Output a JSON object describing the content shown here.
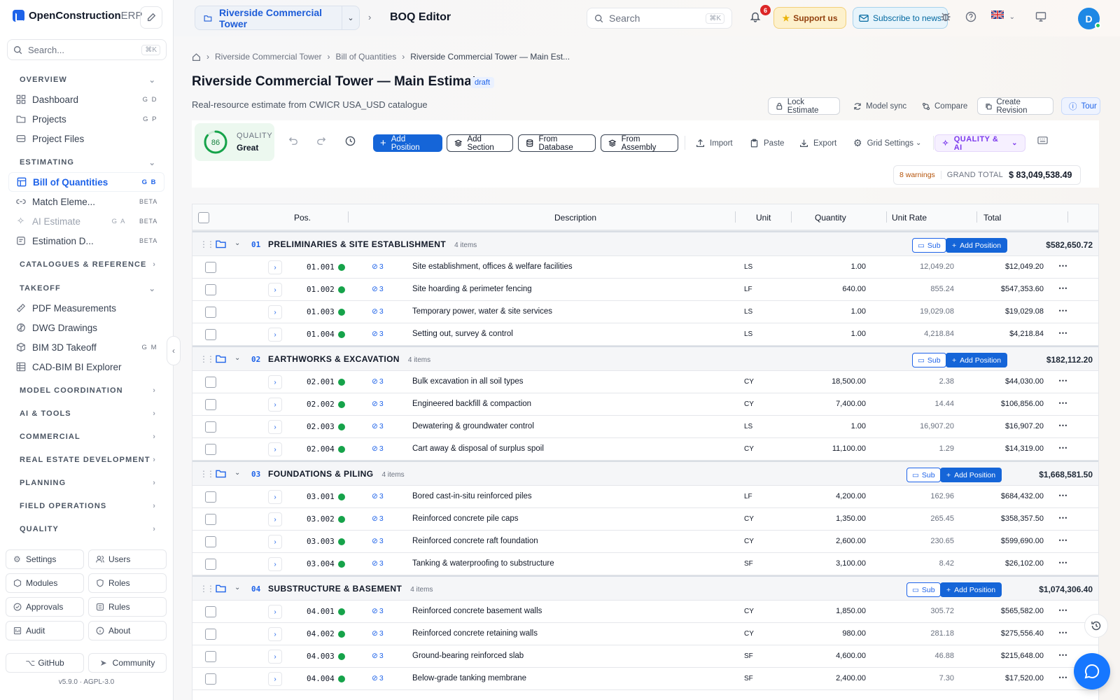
{
  "app": {
    "brand_main": "OpenConstruction",
    "brand_suffix": "ERP",
    "search_placeholder": "Search...",
    "search_shortcut": "⌘K",
    "version": "v5.9.0",
    "license": "AGPL-3.0"
  },
  "sidebar": {
    "sections": [
      {
        "label": "OVERVIEW",
        "expanded": true,
        "items": [
          {
            "label": "Dashboard",
            "icon": "dashboard-icon",
            "shortcut": "G D"
          },
          {
            "label": "Projects",
            "icon": "folder-icon",
            "shortcut": "G P"
          },
          {
            "label": "Project Files",
            "icon": "archive-icon",
            "shortcut": ""
          }
        ]
      },
      {
        "label": "ESTIMATING",
        "expanded": true,
        "items": [
          {
            "label": "Bill of Quantities",
            "icon": "table-icon",
            "shortcut": "G B",
            "active": true
          },
          {
            "label": "Match Eleme...",
            "icon": "link-icon",
            "badge": "BETA"
          },
          {
            "label": "AI Estimate",
            "icon": "sparkle-icon",
            "shortcut": "G A",
            "badge": "BETA",
            "dim": true
          },
          {
            "label": "Estimation D...",
            "icon": "note-icon",
            "badge": "BETA"
          }
        ]
      },
      {
        "label": "CATALOGUES & REFERENCE",
        "expanded": false,
        "items": []
      },
      {
        "label": "TAKEOFF",
        "expanded": true,
        "items": [
          {
            "label": "PDF Measurements",
            "icon": "ruler-icon",
            "shortcut": ""
          },
          {
            "label": "DWG Drawings",
            "icon": "drawing-icon",
            "shortcut": ""
          },
          {
            "label": "BIM 3D Takeoff",
            "icon": "cube-icon",
            "shortcut": "G M"
          },
          {
            "label": "CAD-BIM BI Explorer",
            "icon": "grid-icon",
            "shortcut": ""
          }
        ]
      },
      {
        "label": "MODEL COORDINATION",
        "expanded": false,
        "items": []
      },
      {
        "label": "AI & TOOLS",
        "expanded": false,
        "items": []
      },
      {
        "label": "COMMERCIAL",
        "expanded": false,
        "items": []
      },
      {
        "label": "REAL ESTATE DEVELOPMENT",
        "expanded": false,
        "items": []
      },
      {
        "label": "PLANNING",
        "expanded": false,
        "items": []
      },
      {
        "label": "FIELD OPERATIONS",
        "expanded": false,
        "items": []
      },
      {
        "label": "QUALITY",
        "expanded": false,
        "items": []
      }
    ],
    "footer": [
      {
        "label": "Settings",
        "icon": "gear-icon"
      },
      {
        "label": "Users",
        "icon": "users-icon"
      },
      {
        "label": "Modules",
        "icon": "box-icon"
      },
      {
        "label": "Roles",
        "icon": "shield-icon"
      },
      {
        "label": "Approvals",
        "icon": "check-circle-icon"
      },
      {
        "label": "Rules",
        "icon": "rules-icon"
      },
      {
        "label": "Audit",
        "icon": "audit-icon"
      },
      {
        "label": "About",
        "icon": "info-icon"
      }
    ],
    "github": "GitHub",
    "community": "Community"
  },
  "topbar": {
    "project": "Riverside Commercial Tower",
    "page": "BOQ Editor",
    "search_placeholder": "Search",
    "search_shortcut": "⌘K",
    "notifications": "6",
    "support": "Support us",
    "subscribe": "Subscribe to news",
    "avatar": "D"
  },
  "page": {
    "breadcrumb": [
      "Riverside Commercial Tower",
      "Bill of Quantities",
      "Riverside Commercial Tower — Main Est..."
    ],
    "title": "Riverside Commercial Tower — Main Estimate",
    "status": "draft",
    "subtitle": "Real-resource estimate from CWICR USA_USD catalogue",
    "actions": {
      "lock": "Lock Estimate",
      "model_sync": "Model sync",
      "compare": "Compare",
      "revision": "Create Revision",
      "tour": "Tour"
    }
  },
  "toolbar": {
    "quality_score": "86",
    "quality_score_value": 0.86,
    "quality_label": "QUALITY",
    "quality_value": "Great",
    "add_position": "Add Position",
    "add_section": "Add Section",
    "from_database": "From Database",
    "from_assembly": "From Assembly",
    "import": "Import",
    "paste": "Paste",
    "export": "Export",
    "grid_settings": "Grid Settings",
    "quality_ai": "QUALITY & AI",
    "warnings": "8 warnings",
    "grand_total_label": "GRAND TOTAL",
    "grand_total": "$ 83,049,538.49"
  },
  "grid": {
    "columns": {
      "pos": "Pos.",
      "description": "Description",
      "unit": "Unit",
      "quantity": "Quantity",
      "unit_rate": "Unit Rate",
      "total": "Total"
    },
    "sub_label": "Sub",
    "add_label": "Add Position",
    "sections": [
      {
        "code": "01",
        "title": "PRELIMINARIES & SITE ESTABLISHMENT",
        "count": "4 items",
        "total": "$582,650.72",
        "rows": [
          {
            "pos": "01.001",
            "links": "3",
            "desc": "Site establishment, offices & welfare facilities",
            "unit": "LS",
            "qty": "1.00",
            "rate": "12,049.20",
            "total": "$12,049.20"
          },
          {
            "pos": "01.002",
            "links": "3",
            "desc": "Site hoarding & perimeter fencing",
            "unit": "LF",
            "qty": "640.00",
            "rate": "855.24",
            "total": "$547,353.60"
          },
          {
            "pos": "01.003",
            "links": "3",
            "desc": "Temporary power, water & site services",
            "unit": "LS",
            "qty": "1.00",
            "rate": "19,029.08",
            "total": "$19,029.08"
          },
          {
            "pos": "01.004",
            "links": "3",
            "desc": "Setting out, survey & control",
            "unit": "LS",
            "qty": "1.00",
            "rate": "4,218.84",
            "total": "$4,218.84"
          }
        ]
      },
      {
        "code": "02",
        "title": "EARTHWORKS & EXCAVATION",
        "count": "4 items",
        "total": "$182,112.20",
        "rows": [
          {
            "pos": "02.001",
            "links": "3",
            "desc": "Bulk excavation in all soil types",
            "unit": "CY",
            "qty": "18,500.00",
            "rate": "2.38",
            "total": "$44,030.00"
          },
          {
            "pos": "02.002",
            "links": "3",
            "desc": "Engineered backfill & compaction",
            "unit": "CY",
            "qty": "7,400.00",
            "rate": "14.44",
            "total": "$106,856.00"
          },
          {
            "pos": "02.003",
            "links": "3",
            "desc": "Dewatering & groundwater control",
            "unit": "LS",
            "qty": "1.00",
            "rate": "16,907.20",
            "total": "$16,907.20"
          },
          {
            "pos": "02.004",
            "links": "3",
            "desc": "Cart away & disposal of surplus spoil",
            "unit": "CY",
            "qty": "11,100.00",
            "rate": "1.29",
            "total": "$14,319.00"
          }
        ]
      },
      {
        "code": "03",
        "title": "FOUNDATIONS & PILING",
        "count": "4 items",
        "total": "$1,668,581.50",
        "rows": [
          {
            "pos": "03.001",
            "links": "3",
            "desc": "Bored cast-in-situ reinforced piles",
            "unit": "LF",
            "qty": "4,200.00",
            "rate": "162.96",
            "total": "$684,432.00"
          },
          {
            "pos": "03.002",
            "links": "3",
            "desc": "Reinforced concrete pile caps",
            "unit": "CY",
            "qty": "1,350.00",
            "rate": "265.45",
            "total": "$358,357.50"
          },
          {
            "pos": "03.003",
            "links": "3",
            "desc": "Reinforced concrete raft foundation",
            "unit": "CY",
            "qty": "2,600.00",
            "rate": "230.65",
            "total": "$599,690.00"
          },
          {
            "pos": "03.004",
            "links": "3",
            "desc": "Tanking & waterproofing to substructure",
            "unit": "SF",
            "qty": "3,100.00",
            "rate": "8.42",
            "total": "$26,102.00"
          }
        ]
      },
      {
        "code": "04",
        "title": "SUBSTRUCTURE & BASEMENT",
        "count": "4 items",
        "total": "$1,074,306.40",
        "rows": [
          {
            "pos": "04.001",
            "links": "3",
            "desc": "Reinforced concrete basement walls",
            "unit": "CY",
            "qty": "1,850.00",
            "rate": "305.72",
            "total": "$565,582.00"
          },
          {
            "pos": "04.002",
            "links": "3",
            "desc": "Reinforced concrete retaining walls",
            "unit": "CY",
            "qty": "980.00",
            "rate": "281.18",
            "total": "$275,556.40"
          },
          {
            "pos": "04.003",
            "links": "3",
            "desc": "Ground-bearing reinforced slab",
            "unit": "SF",
            "qty": "4,600.00",
            "rate": "46.88",
            "total": "$215,648.00"
          },
          {
            "pos": "04.004",
            "links": "3",
            "desc": "Below-grade tanking membrane",
            "unit": "SF",
            "qty": "2,400.00",
            "rate": "7.30",
            "total": "$17,520.00"
          }
        ]
      }
    ]
  },
  "colors": {
    "accent": "#1565d8",
    "success": "#16a34a",
    "warning": "#b45309",
    "qa": "#7c3aed"
  }
}
